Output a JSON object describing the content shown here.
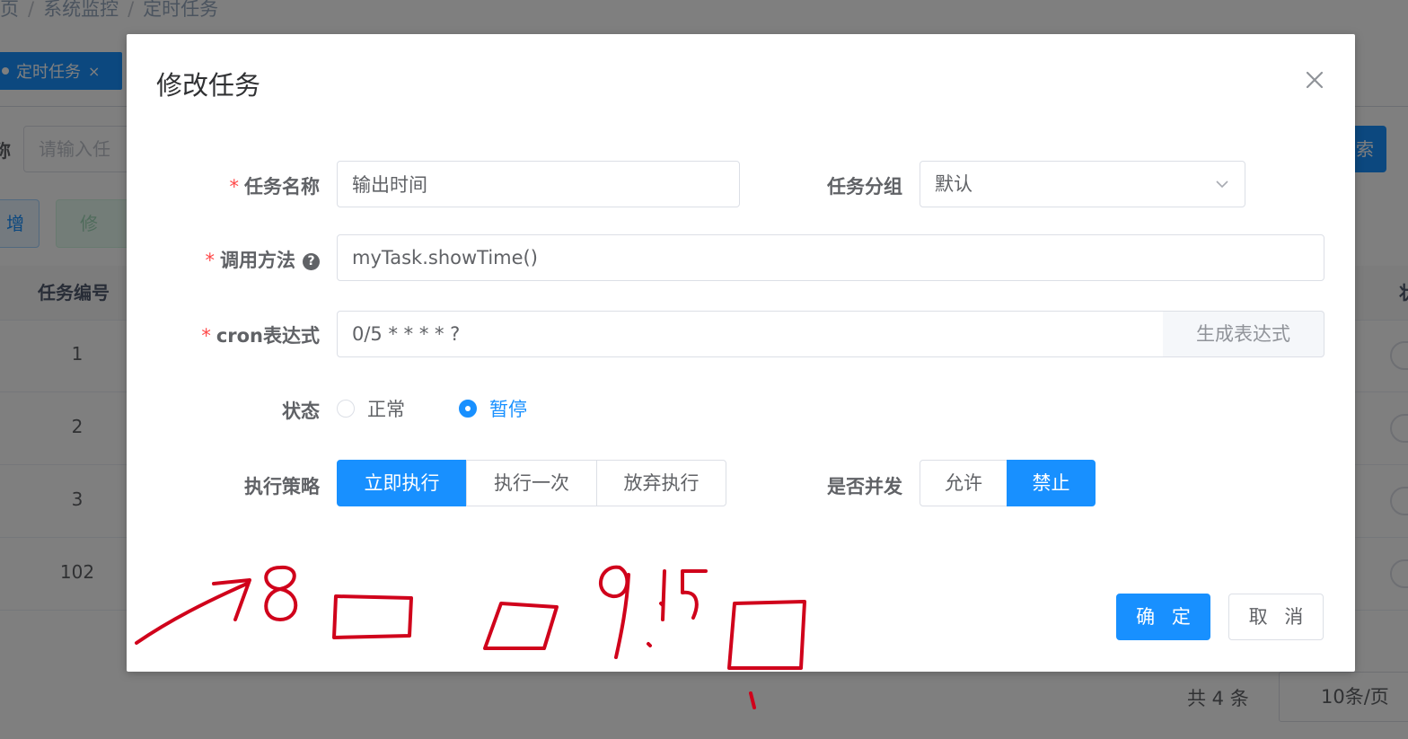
{
  "background": {
    "breadcrumb": [
      "页",
      "系统监控",
      "定时任务"
    ],
    "active_tag": "定时任务",
    "search_label": "称",
    "search_placeholder": "请输入任",
    "search_button": "索",
    "button_blue": "增",
    "button_green": "修",
    "table_header_id": "任务编号",
    "table_header_right": "状",
    "rows": [
      "1",
      "2",
      "3",
      "102"
    ],
    "pager_total": "共 4 条",
    "pager_size": "10条/页"
  },
  "dialog": {
    "title": "修改任务",
    "fields": {
      "job_name": {
        "label": "任务名称",
        "value": "输出时间"
      },
      "job_group": {
        "label": "任务分组",
        "value": "默认"
      },
      "invoke_target": {
        "label": "调用方法",
        "value": "myTask.showTime()"
      },
      "cron": {
        "label": "cron表达式",
        "value": "0/5 * * * * ?",
        "append_button": "生成表达式"
      },
      "status": {
        "label": "状态",
        "options": [
          "正常",
          "暂停"
        ],
        "selected": "暂停"
      },
      "misfire_policy": {
        "label": "执行策略",
        "options": [
          "立即执行",
          "执行一次",
          "放弃执行"
        ],
        "selected": "立即执行"
      },
      "concurrent": {
        "label": "是否并发",
        "options": [
          "允许",
          "禁止"
        ],
        "selected": "禁止"
      }
    },
    "confirm_label": "确 定",
    "cancel_label": "取 消"
  },
  "annotation": {
    "text": "→8 ▭ ▭ 9:15 ▭",
    "color": "#d0021b"
  }
}
